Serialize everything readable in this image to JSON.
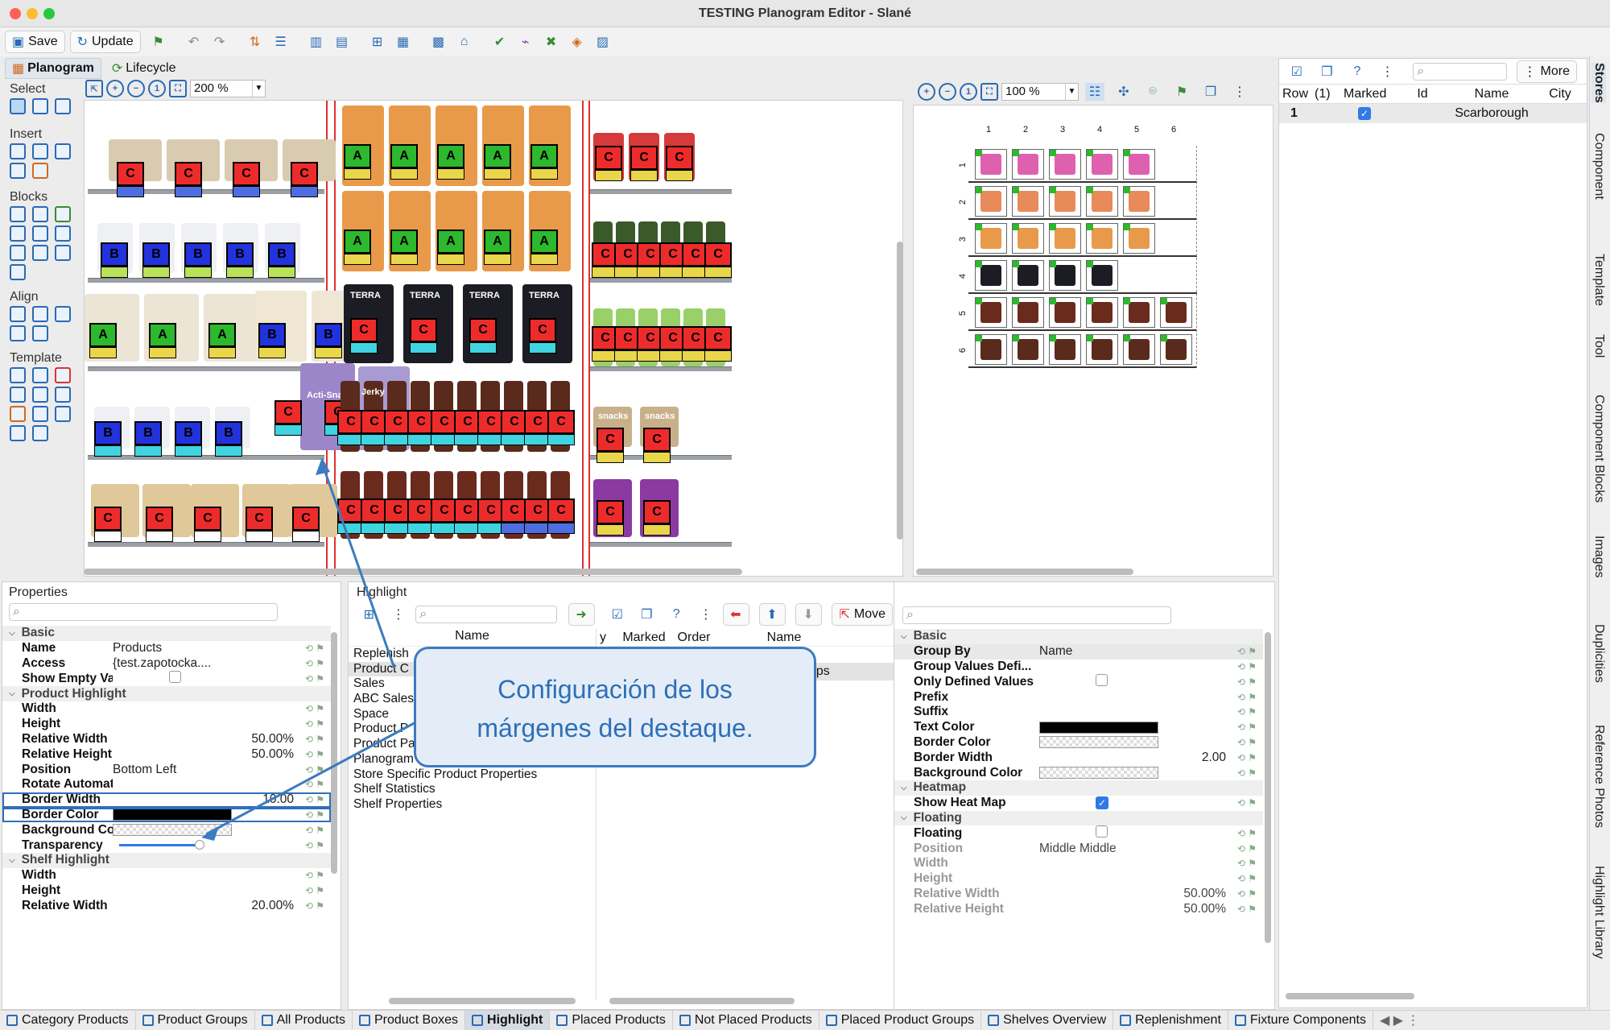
{
  "window": {
    "title": "TESTING Planogram Editor - Slané"
  },
  "toolbar": {
    "save_label": "Save",
    "update_label": "Update"
  },
  "main_tabs": [
    {
      "label": "Planogram"
    },
    {
      "label": "Lifecycle"
    }
  ],
  "left_tools": {
    "select": "Select",
    "insert": "Insert",
    "blocks": "Blocks",
    "align": "Align",
    "template": "Template"
  },
  "planogram": {
    "zoom": "200 %"
  },
  "product_tags": {
    "a": "A",
    "b": "B",
    "c": "C"
  },
  "brand_labels": {
    "terra": "TERRA",
    "acti": "Acti-Snack",
    "jerky": "Jerky",
    "snacks": "snacks"
  },
  "grid": {
    "zoom": "100 %",
    "col_labels": [
      "1",
      "2",
      "3",
      "4",
      "5",
      "6"
    ],
    "row_labels": [
      "1",
      "2",
      "3",
      "4",
      "5",
      "6"
    ]
  },
  "stores": {
    "more_label": "More",
    "columns": [
      "Row",
      "(1)",
      "Marked",
      "Id",
      "Name",
      "City"
    ],
    "rows": [
      {
        "row": "1",
        "marked": true,
        "id": "",
        "name": "Scarborough",
        "city": ""
      }
    ]
  },
  "properties": {
    "title": "Properties",
    "items": [
      {
        "type": "cat",
        "label": "Basic"
      },
      {
        "type": "row",
        "k": "Name",
        "v": "Products"
      },
      {
        "type": "row",
        "k": "Access",
        "v": "{test.zapotocka...."
      },
      {
        "type": "row",
        "k": "Show Empty Values",
        "v": "",
        "check": "empty"
      },
      {
        "type": "cat",
        "label": "Product Highlight"
      },
      {
        "type": "row",
        "k": "Width",
        "v": ""
      },
      {
        "type": "row",
        "k": "Height",
        "v": ""
      },
      {
        "type": "row",
        "k": "Relative Width",
        "v": "50.00%",
        "align": "right"
      },
      {
        "type": "row",
        "k": "Relative Height",
        "v": "50.00%",
        "align": "right"
      },
      {
        "type": "row",
        "k": "Position",
        "v": "Bottom Left"
      },
      {
        "type": "row",
        "k": "Rotate Automatical...",
        "v": ""
      },
      {
        "type": "row",
        "k": "Border Width",
        "v": "10.00",
        "align": "right",
        "boxed": true
      },
      {
        "type": "row",
        "k": "Border Color",
        "v": "",
        "swatch": "#000000",
        "boxed": true
      },
      {
        "type": "row",
        "k": "Background Color",
        "v": "",
        "swatch": "checker"
      },
      {
        "type": "row",
        "k": "Transparency",
        "v": "",
        "slider": true
      },
      {
        "type": "cat",
        "label": "Shelf Highlight"
      },
      {
        "type": "row",
        "k": "Width",
        "v": ""
      },
      {
        "type": "row",
        "k": "Height",
        "v": ""
      },
      {
        "type": "row",
        "k": "Relative Width",
        "v": "20.00%",
        "align": "right"
      }
    ]
  },
  "highlight": {
    "title": "Highlight",
    "list": [
      "Replenish",
      "Product C",
      "Sales",
      "ABC Sales",
      "Space",
      "Product P",
      "Product Package Properties",
      "Planogram Placement",
      "Store Specific Product Properties",
      "Shelf Statistics",
      "Shelf Properties"
    ],
    "columns": [
      "Name",
      "y",
      "Marked",
      "Order",
      "Name"
    ],
    "partial_value": "ups",
    "move_label": "Move"
  },
  "highlight_props": {
    "items": [
      {
        "type": "cat",
        "label": "Basic"
      },
      {
        "type": "row",
        "k": "Group By",
        "v": "Name",
        "shade": true
      },
      {
        "type": "row",
        "k": "Group Values Defi...",
        "v": ""
      },
      {
        "type": "row",
        "k": "Only Defined Values",
        "v": "",
        "check": "empty"
      },
      {
        "type": "row",
        "k": "Prefix",
        "v": ""
      },
      {
        "type": "row",
        "k": "Suffix",
        "v": ""
      },
      {
        "type": "row",
        "k": "Text Color",
        "v": "",
        "swatch": "#000000"
      },
      {
        "type": "row",
        "k": "Border Color",
        "v": "",
        "swatch": "checker"
      },
      {
        "type": "row",
        "k": "Border Width",
        "v": "2.00",
        "align": "right"
      },
      {
        "type": "row",
        "k": "Background Color",
        "v": "",
        "swatch": "checker"
      },
      {
        "type": "cat",
        "label": "Heatmap"
      },
      {
        "type": "row",
        "k": "Show Heat Map",
        "v": "",
        "check": "on"
      },
      {
        "type": "cat",
        "label": "Floating"
      },
      {
        "type": "row",
        "k": "Floating",
        "v": "",
        "check": "empty"
      },
      {
        "type": "row",
        "k": "Position",
        "v": "Middle Middle",
        "dim": true
      },
      {
        "type": "row",
        "k": "Width",
        "v": "",
        "dim": true
      },
      {
        "type": "row",
        "k": "Height",
        "v": "",
        "dim": true
      },
      {
        "type": "row",
        "k": "Relative Width",
        "v": "50.00%",
        "align": "right",
        "dim": true
      },
      {
        "type": "row",
        "k": "Relative Height",
        "v": "50.00%",
        "align": "right",
        "dim": true
      }
    ]
  },
  "callout": {
    "line1": "Configuración de los",
    "line2": "márgenes del destaque."
  },
  "bottom_tabs": [
    "Category Products",
    "Product Groups",
    "All Products",
    "Product Boxes",
    "Highlight",
    "Placed Products",
    "Not Placed Products",
    "Placed Product Groups",
    "Shelves Overview",
    "Replenishment",
    "Fixture Components"
  ],
  "side_tabs": [
    "Stores",
    "Component",
    "Template",
    "Tool",
    "Component Blocks",
    "Images",
    "Duplicities",
    "Reference Photos",
    "Highlight Library"
  ],
  "colors": {
    "tag_a": "#2db82d",
    "tag_b": "#2233dd",
    "tag_c": "#ee2b2b",
    "tag_bottom_green": "#b9e25a",
    "tag_bottom_blue": "#4d6de0",
    "tag_bottom_cyan": "#3fd4e0",
    "accent": "#2f6fb8"
  }
}
